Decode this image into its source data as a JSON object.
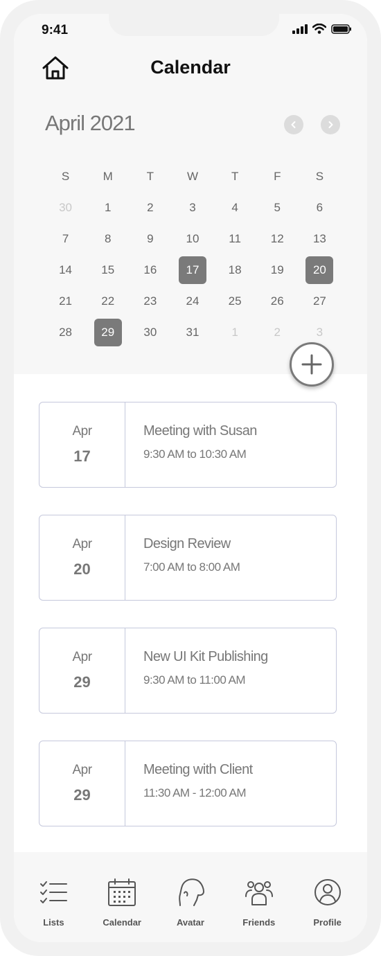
{
  "status": {
    "time": "9:41"
  },
  "header": {
    "title": "Calendar"
  },
  "calendar": {
    "month_label": "April 2021",
    "weekdays": [
      "S",
      "M",
      "T",
      "W",
      "T",
      "F",
      "S"
    ],
    "weeks": [
      [
        {
          "d": "30",
          "muted": true
        },
        {
          "d": "1"
        },
        {
          "d": "2"
        },
        {
          "d": "3"
        },
        {
          "d": "4"
        },
        {
          "d": "5"
        },
        {
          "d": "6"
        }
      ],
      [
        {
          "d": "7"
        },
        {
          "d": "8"
        },
        {
          "d": "9"
        },
        {
          "d": "10"
        },
        {
          "d": "11"
        },
        {
          "d": "12"
        },
        {
          "d": "13"
        }
      ],
      [
        {
          "d": "14"
        },
        {
          "d": "15"
        },
        {
          "d": "16"
        },
        {
          "d": "17",
          "marked": true
        },
        {
          "d": "18"
        },
        {
          "d": "19"
        },
        {
          "d": "20",
          "marked": true
        }
      ],
      [
        {
          "d": "21"
        },
        {
          "d": "22"
        },
        {
          "d": "23"
        },
        {
          "d": "24"
        },
        {
          "d": "25"
        },
        {
          "d": "26"
        },
        {
          "d": "27"
        }
      ],
      [
        {
          "d": "28"
        },
        {
          "d": "29",
          "marked": true
        },
        {
          "d": "30"
        },
        {
          "d": "31"
        },
        {
          "d": "1",
          "muted": true
        },
        {
          "d": "2",
          "muted": true
        },
        {
          "d": "3",
          "muted": true
        }
      ]
    ]
  },
  "events": [
    {
      "month": "Apr",
      "day": "17",
      "title": "Meeting with Susan",
      "time": "9:30 AM to 10:30 AM"
    },
    {
      "month": "Apr",
      "day": "20",
      "title": "Design Review",
      "time": "7:00 AM to 8:00 AM"
    },
    {
      "month": "Apr",
      "day": "29",
      "title": "New UI Kit Publishing",
      "time": "9:30 AM to 11:00 AM"
    },
    {
      "month": "Apr",
      "day": "29",
      "title": "Meeting with Client",
      "time": "11:30 AM - 12:00 AM"
    }
  ],
  "tabs": [
    {
      "label": "Lists",
      "icon": "list-icon"
    },
    {
      "label": "Calendar",
      "icon": "calendar-icon"
    },
    {
      "label": "Avatar",
      "icon": "avatar-icon"
    },
    {
      "label": "Friends",
      "icon": "friends-icon"
    },
    {
      "label": "Profile",
      "icon": "profile-icon"
    }
  ]
}
